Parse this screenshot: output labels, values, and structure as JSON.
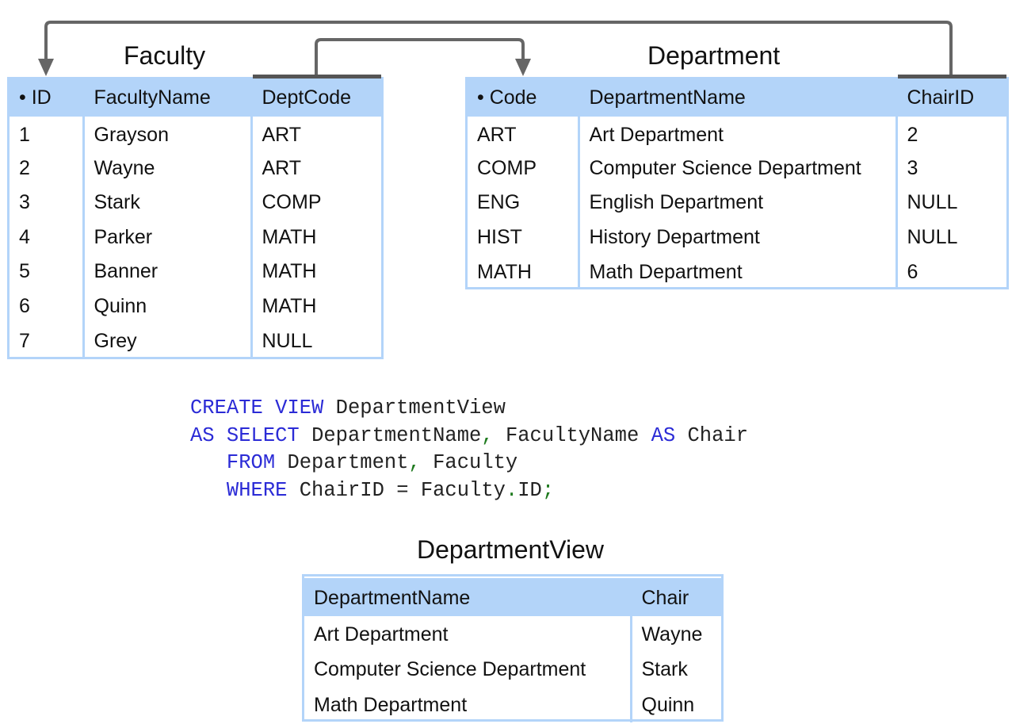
{
  "faculty": {
    "title": "Faculty",
    "columns": [
      "• ID",
      "FacultyName",
      "DeptCode"
    ],
    "rows": [
      [
        "1",
        "Grayson",
        "ART"
      ],
      [
        "2",
        "Wayne",
        "ART"
      ],
      [
        "3",
        "Stark",
        "COMP"
      ],
      [
        "4",
        "Parker",
        "MATH"
      ],
      [
        "5",
        "Banner",
        "MATH"
      ],
      [
        "6",
        "Quinn",
        "MATH"
      ],
      [
        "7",
        "Grey",
        "NULL"
      ]
    ]
  },
  "department": {
    "title": "Department",
    "columns": [
      "• Code",
      "DepartmentName",
      "ChairID"
    ],
    "rows": [
      [
        "ART",
        "Art Department",
        "2"
      ],
      [
        "COMP",
        "Computer Science Department",
        "3"
      ],
      [
        "ENG",
        "English Department",
        "NULL"
      ],
      [
        "HIST",
        "History Department",
        "NULL"
      ],
      [
        "MATH",
        "Math Department",
        "6"
      ]
    ]
  },
  "sql": {
    "line1": {
      "create": "CREATE",
      "view": "VIEW",
      "name": "DepartmentView"
    },
    "line2": {
      "as1": "AS",
      "select": "SELECT",
      "col1": "DepartmentName",
      "comma": ",",
      "col2": "FacultyName",
      "as2": "AS",
      "alias": "Chair"
    },
    "line3": {
      "from": "FROM",
      "t1": "Department",
      "comma": ",",
      "t2": "Faculty"
    },
    "line4": {
      "where": "WHERE",
      "lhs": "ChairID",
      "eq": "=",
      "rhs_table": "Faculty",
      "dot": ".",
      "rhs_col": "ID",
      "semi": ";"
    }
  },
  "view": {
    "title": "DepartmentView",
    "columns": [
      "DepartmentName",
      "Chair"
    ],
    "rows": [
      [
        "Art Department",
        "Wayne"
      ],
      [
        "Computer Science Department",
        "Stark"
      ],
      [
        "Math Department",
        "Quinn"
      ]
    ]
  },
  "colors": {
    "header_bg": "#b3d4f9",
    "arrow": "#666666",
    "keyword": "#2b2bd6",
    "punctuation": "#1e7a1e"
  }
}
